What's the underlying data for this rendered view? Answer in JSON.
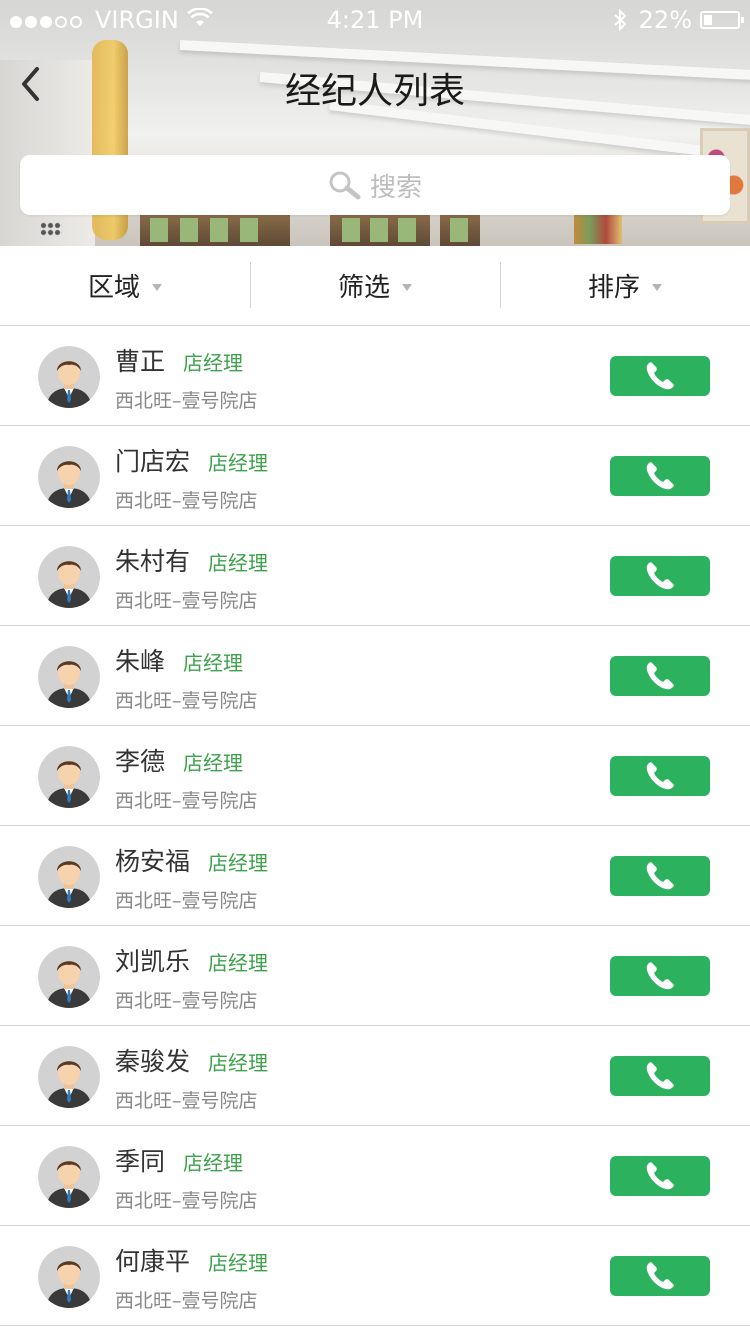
{
  "status_bar": {
    "carrier": "VIRGIN",
    "time": "4:21 PM",
    "battery": "22%",
    "battery_level": 0.22,
    "signal_bars_filled": 3,
    "signal_bars_total": 5
  },
  "header": {
    "title": "经纪人列表",
    "back_icon": "chevron-left-icon"
  },
  "search": {
    "placeholder": "搜索",
    "icon": "search-icon"
  },
  "filters": [
    {
      "label": "区域"
    },
    {
      "label": "筛选"
    },
    {
      "label": "排序"
    }
  ],
  "agents": [
    {
      "name": "曹正",
      "role": "店经理",
      "store": "西北旺–壹号院店"
    },
    {
      "name": "门店宏",
      "role": "店经理",
      "store": "西北旺–壹号院店"
    },
    {
      "name": "朱村有",
      "role": "店经理",
      "store": "西北旺–壹号院店"
    },
    {
      "name": "朱峰",
      "role": "店经理",
      "store": "西北旺–壹号院店"
    },
    {
      "name": "李德",
      "role": "店经理",
      "store": "西北旺–壹号院店"
    },
    {
      "name": "杨安福",
      "role": "店经理",
      "store": "西北旺–壹号院店"
    },
    {
      "name": "刘凯乐",
      "role": "店经理",
      "store": "西北旺–壹号院店"
    },
    {
      "name": "秦骏发",
      "role": "店经理",
      "store": "西北旺–壹号院店"
    },
    {
      "name": "季同",
      "role": "店经理",
      "store": "西北旺–壹号院店"
    },
    {
      "name": "何康平",
      "role": "店经理",
      "store": "西北旺–壹号院店"
    }
  ],
  "colors": {
    "accent_green": "#2cb25f",
    "role_green": "#3da24b",
    "divider": "#d4d4d4"
  }
}
